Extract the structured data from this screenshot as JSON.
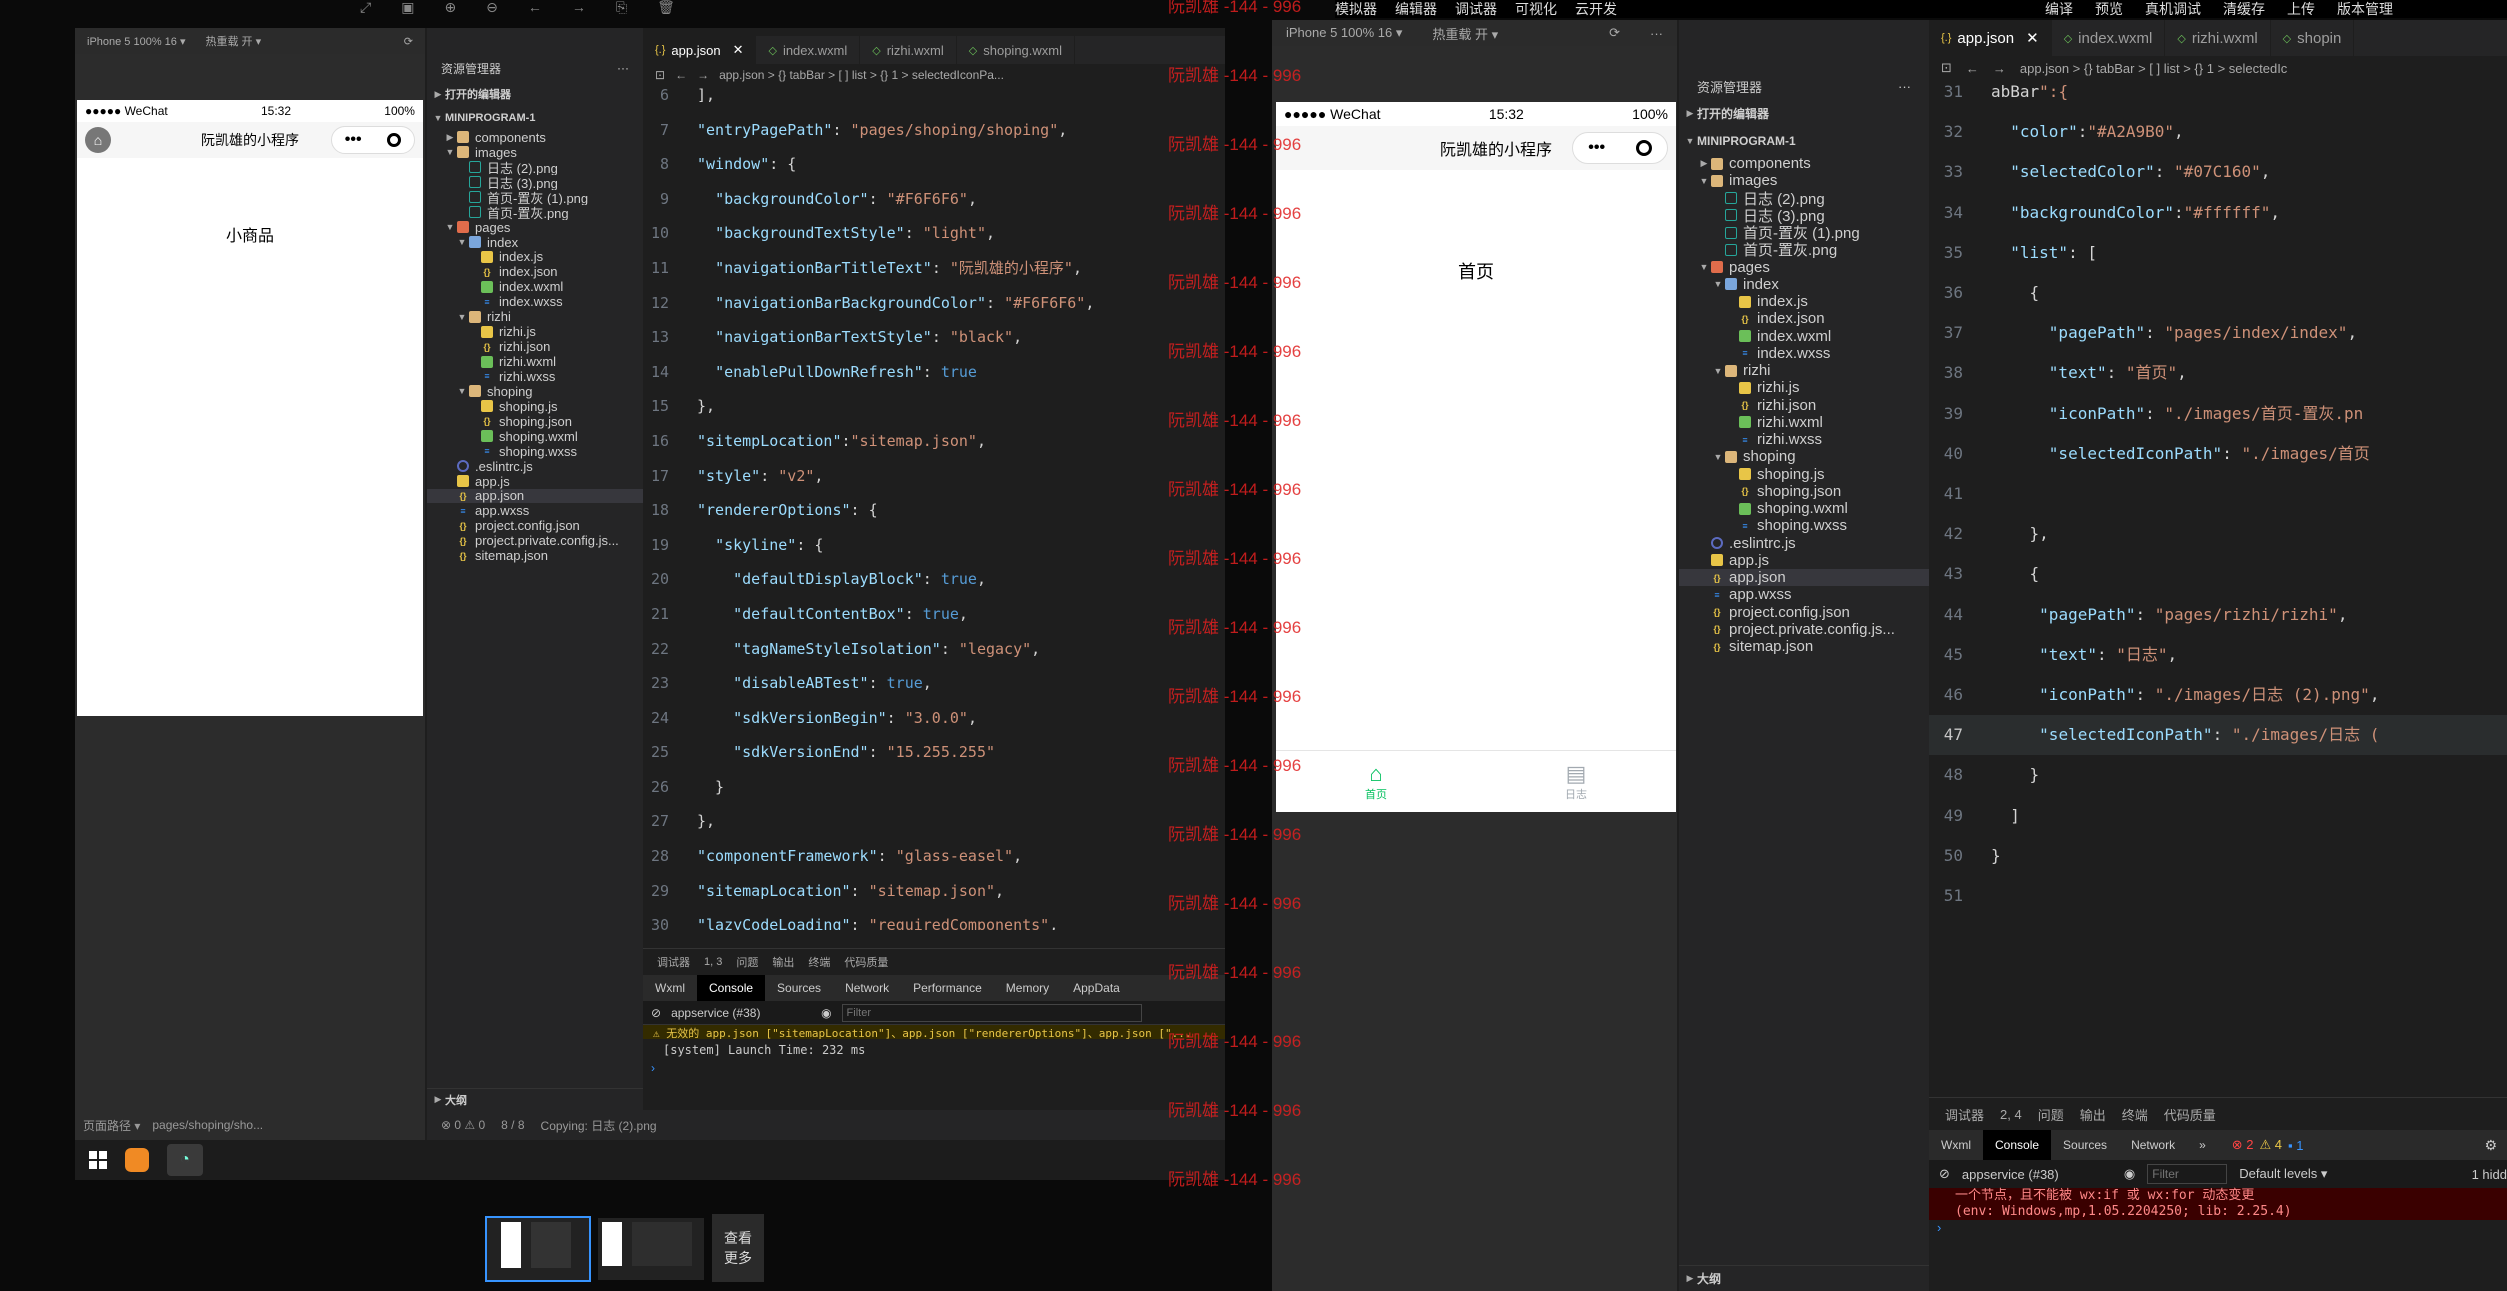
{
  "top_menu": [
    "模拟器",
    "编辑器",
    "调试器",
    "可视化",
    "云开发"
  ],
  "top_right_menu": [
    "编译",
    "预览",
    "真机调试",
    "清缓存",
    "上传",
    "版本管理"
  ],
  "win1": {
    "sim_device": "iPhone 5 100% 16 ▾",
    "sim_reload": "热重载 开 ▾",
    "status_carrier": "●●●●● WeChat",
    "status_time": "15:32",
    "status_battery": "100%",
    "nav_title": "阮凯雄的小程序",
    "page_content": "小商品",
    "explorer_title": "资源管理器",
    "open_editors": "打开的编辑器",
    "project": "MINIPROGRAM-1",
    "tree": [
      {
        "name": "components",
        "type": "folder",
        "depth": 1,
        "open": false
      },
      {
        "name": "images",
        "type": "folder",
        "depth": 1,
        "open": true
      },
      {
        "name": "日志 (2).png",
        "type": "img",
        "depth": 2
      },
      {
        "name": "日志 (3).png",
        "type": "img",
        "depth": 2
      },
      {
        "name": "首页-置灰 (1).png",
        "type": "img",
        "depth": 2
      },
      {
        "name": "首页-置灰.png",
        "type": "img",
        "depth": 2
      },
      {
        "name": "pages",
        "type": "folder-red",
        "depth": 1,
        "open": true
      },
      {
        "name": "index",
        "type": "folder-blue",
        "depth": 2,
        "open": true
      },
      {
        "name": "index.js",
        "type": "js",
        "depth": 3
      },
      {
        "name": "index.json",
        "type": "json",
        "depth": 3
      },
      {
        "name": "index.wxml",
        "type": "wxml",
        "depth": 3
      },
      {
        "name": "index.wxss",
        "type": "wxss",
        "depth": 3
      },
      {
        "name": "rizhi",
        "type": "folder",
        "depth": 2,
        "open": true
      },
      {
        "name": "rizhi.js",
        "type": "js",
        "depth": 3
      },
      {
        "name": "rizhi.json",
        "type": "json",
        "depth": 3
      },
      {
        "name": "rizhi.wxml",
        "type": "wxml",
        "depth": 3
      },
      {
        "name": "rizhi.wxss",
        "type": "wxss",
        "depth": 3
      },
      {
        "name": "shoping",
        "type": "folder",
        "depth": 2,
        "open": true
      },
      {
        "name": "shoping.js",
        "type": "js",
        "depth": 3
      },
      {
        "name": "shoping.json",
        "type": "json",
        "depth": 3
      },
      {
        "name": "shoping.wxml",
        "type": "wxml",
        "depth": 3
      },
      {
        "name": "shoping.wxss",
        "type": "wxss",
        "depth": 3
      },
      {
        "name": ".eslintrc.js",
        "type": "rc",
        "depth": 1
      },
      {
        "name": "app.js",
        "type": "js",
        "depth": 1
      },
      {
        "name": "app.json",
        "type": "json",
        "depth": 1,
        "selected": true
      },
      {
        "name": "app.wxss",
        "type": "wxss",
        "depth": 1
      },
      {
        "name": "project.config.json",
        "type": "json",
        "depth": 1
      },
      {
        "name": "project.private.config.js...",
        "type": "json",
        "depth": 1
      },
      {
        "name": "sitemap.json",
        "type": "json",
        "depth": 1
      }
    ],
    "outline": "大纲",
    "tabs": [
      {
        "label": "app.json",
        "icon": "{.}",
        "active": true
      },
      {
        "label": "index.wxml",
        "icon": "◇"
      },
      {
        "label": "rizhi.wxml",
        "icon": "◇"
      },
      {
        "label": "shoping.wxml",
        "icon": "◇"
      }
    ],
    "breadcrumb": "app.json > {} tabBar > [ ] list > {} 1 > selectedIconPa...",
    "code": [
      {
        "n": "6",
        "t": "],"
      },
      {
        "n": "7",
        "t": "\"entryPagePath\": \"pages/shoping/shoping\","
      },
      {
        "n": "8",
        "t": "\"window\": {"
      },
      {
        "n": "9",
        "t": "  \"backgroundColor\": \"#F6F6F6\","
      },
      {
        "n": "10",
        "t": "  \"backgroundTextStyle\": \"light\","
      },
      {
        "n": "11",
        "t": "  \"navigationBarTitleText\": \"阮凯雄的小程序\","
      },
      {
        "n": "12",
        "t": "  \"navigationBarBackgroundColor\": \"#F6F6F6\","
      },
      {
        "n": "13",
        "t": "  \"navigationBarTextStyle\": \"black\","
      },
      {
        "n": "14",
        "t": "  \"enablePullDownRefresh\": true"
      },
      {
        "n": "15",
        "t": "},"
      },
      {
        "n": "16",
        "t": "\"sitempLocation\":\"sitemap.json\","
      },
      {
        "n": "17",
        "t": "\"style\": \"v2\","
      },
      {
        "n": "18",
        "t": "\"rendererOptions\": {"
      },
      {
        "n": "19",
        "t": "  \"skyline\": {"
      },
      {
        "n": "20",
        "t": "    \"defaultDisplayBlock\": true,"
      },
      {
        "n": "21",
        "t": "    \"defaultContentBox\": true,"
      },
      {
        "n": "22",
        "t": "    \"tagNameStyleIsolation\": \"legacy\","
      },
      {
        "n": "23",
        "t": "    \"disableABTest\": true,"
      },
      {
        "n": "24",
        "t": "    \"sdkVersionBegin\": \"3.0.0\","
      },
      {
        "n": "25",
        "t": "    \"sdkVersionEnd\": \"15.255.255\""
      },
      {
        "n": "26",
        "t": "  }"
      },
      {
        "n": "27",
        "t": "},"
      },
      {
        "n": "28",
        "t": "\"componentFramework\": \"glass-easel\","
      },
      {
        "n": "29",
        "t": "\"sitemapLocation\": \"sitemap.json\","
      },
      {
        "n": "30",
        "t": "\"lazyCodeLoading\": \"requiredComponents\","
      }
    ],
    "debug_tabs": [
      "调试器",
      "1, 3",
      "问题",
      "输出",
      "终端",
      "代码质量"
    ],
    "devtools_tabs": [
      "Wxml",
      "Console",
      "Sources",
      "Network",
      "Performance",
      "Memory",
      "AppData"
    ],
    "context": "appservice (#38)",
    "filter_placeholder": "Filter",
    "console_warn": "⚠ 无效的 app.json [\"sitemapLocation\"]、app.json [\"rendererOptions\"]、app.json [\"...",
    "console_log": "[system] Launch Time: 232 ms",
    "status_path_label": "页面路径 ▾",
    "status_path": "pages/shoping/sho...",
    "status_errors": "⊗ 0 ⚠ 0",
    "status_lines": "8 / 8",
    "status_copy": "Copying: 日志 (2).png"
  },
  "win2": {
    "sim_device": "iPhone 5 100% 16 ▾",
    "sim_reload": "热重载 开 ▾",
    "status_carrier": "●●●●● WeChat",
    "status_time": "15:32",
    "status_battery": "100%",
    "nav_title": "阮凯雄的小程序",
    "page_content": "首页",
    "tabbar": [
      {
        "label": "首页",
        "active": true
      },
      {
        "label": "日志",
        "active": false
      }
    ],
    "explorer_title": "资源管理器",
    "open_editors": "打开的编辑器",
    "project": "MINIPROGRAM-1",
    "outline": "大纲",
    "tabs": [
      {
        "label": "app.json",
        "icon": "{.}",
        "active": true
      },
      {
        "label": "index.wxml",
        "icon": "◇"
      },
      {
        "label": "rizhi.wxml",
        "icon": "◇"
      },
      {
        "label": "shopin",
        "icon": "◇"
      }
    ],
    "breadcrumb": "app.json > {} tabBar > [ ] list > {} 1 > selectedIc",
    "code": [
      {
        "n": "31",
        "t": "abBar\":{"
      },
      {
        "n": "32",
        "t": "  \"color\":\"#A2A9B0\","
      },
      {
        "n": "33",
        "t": "  \"selectedColor\": \"#07C160\","
      },
      {
        "n": "34",
        "t": "  \"backgroundColor\":\"#ffffff\","
      },
      {
        "n": "35",
        "t": "  \"list\": ["
      },
      {
        "n": "36",
        "t": "    {"
      },
      {
        "n": "37",
        "t": "      \"pagePath\": \"pages/index/index\","
      },
      {
        "n": "38",
        "t": "      \"text\": \"首页\","
      },
      {
        "n": "39",
        "t": "      \"iconPath\": \"./images/首页-置灰.pn"
      },
      {
        "n": "40",
        "t": "      \"selectedIconPath\": \"./images/首页"
      },
      {
        "n": "41",
        "t": ""
      },
      {
        "n": "42",
        "t": "    },"
      },
      {
        "n": "43",
        "t": "    {"
      },
      {
        "n": "44",
        "t": "     \"pagePath\": \"pages/rizhi/rizhi\","
      },
      {
        "n": "45",
        "t": "     \"text\": \"日志\","
      },
      {
        "n": "46",
        "t": "     \"iconPath\": \"./images/日志 (2).png\","
      },
      {
        "n": "47",
        "t": "     \"selectedIconPath\": \"./images/日志 ("
      },
      {
        "n": "48",
        "t": "    }"
      },
      {
        "n": "49",
        "t": "  ]"
      },
      {
        "n": "50",
        "t": "}"
      },
      {
        "n": "51",
        "t": ""
      }
    ],
    "debug_tabs": [
      "调试器",
      "2, 4",
      "问题",
      "输出",
      "终端",
      "代码质量"
    ],
    "devtools_tabs": [
      "Wxml",
      "Console",
      "Sources",
      "Network",
      "»"
    ],
    "badge_errors": "⊗ 2",
    "badge_warn": "⚠ 4",
    "badge_info": "▪ 1",
    "context": "appservice (#38)",
    "filter_placeholder": "Filter",
    "levels": "Default levels ▾",
    "hidden": "1 hidd",
    "console_err1": "一个节点，且不能被 wx:if 或 wx:for 动态变更",
    "console_err2": "(env: Windows,mp,1.05.2204250; lib: 2.25.4)"
  },
  "watermark": "阮凯雄 -144 - 996",
  "taskbar_more": "查看\n更多"
}
